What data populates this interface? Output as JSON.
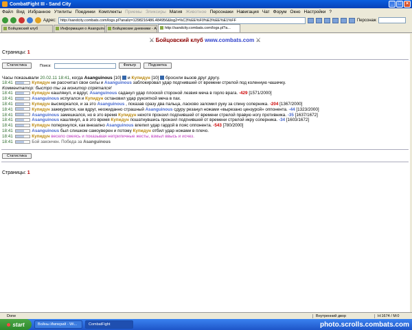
{
  "window": {
    "title": "CombatFight III - Sand City"
  },
  "menu": [
    "Файл",
    "Вид",
    "Избранное",
    "Утилиты",
    "Поединки",
    "Комплекты",
    "Приемы",
    "Эликсиры",
    "Магия",
    "Животное",
    "Персонажи",
    "Навигация",
    "Чат",
    "Форум",
    "Окно",
    "Настройки",
    "?"
  ],
  "menu_disabled": [
    "Приемы",
    "Эликсиры",
    "Животное"
  ],
  "toolbar": {
    "address_label": "Адрес:",
    "address_value": "http://sandcity.combats.com/logs.pl?analiz=1298216486.484956&log2=%C3%EE%F0%E3%EE%E1%FF",
    "persons_label": "Персонаж"
  },
  "tabs": [
    {
      "label": "Бойцовский клуб"
    },
    {
      "label": "Информация о Asanguinous"
    },
    {
      "label": "Бойцовские дневники - Asanguinous"
    },
    {
      "label": "http://sandcity.combats.com/logs.pl?a..."
    }
  ],
  "page": {
    "club_title": "Бойцовский клуб",
    "club_site": "www.combats.com",
    "pages_label": "Страницы:",
    "pages_value": "1",
    "buttons": {
      "stats": "Статистика",
      "search_label": "Поиск:",
      "filter": "Фильтр",
      "highlight": "Подсветка"
    },
    "intro": {
      "a": "Часы показывали",
      "time": "20.02.11 18:41",
      "b": ", когда",
      "p1": "Asanguinous",
      "p1lvl": "[10]",
      "c": "и",
      "p2": "Купидун",
      "p2lvl": "[10]",
      "d": "бросили вызов друг другу."
    },
    "log": [
      {
        "t": "18:41",
        "actor": "Купидун",
        "actor_color": "red",
        "text": "не рассчитал свои силы и",
        "target": "Asanguinous",
        "target_color": "blue",
        "rest": "заблокировал удар подгнившей от времени стрелой под коленную чашечку.",
        "dmg": "",
        "hp": ""
      },
      {
        "t": "",
        "comment": "Комментатор: быстро ты за монитор спрятался!"
      },
      {
        "t": "18:41",
        "actor": "Купидун",
        "actor_color": "red",
        "text": "кашлянул, и вдруг,",
        "target": "Asanguinous",
        "target_color": "blue",
        "rest": "саданул удар плоской стороной лезвия меча в горло врага.",
        "dmg": "-429",
        "hp": "[1571/2000]"
      },
      {
        "t": "18:41",
        "actor": "Asanguinous",
        "actor_color": "blue",
        "text": "испугался и",
        "target": "Купидун",
        "target_color": "red",
        "rest": "остановил удар рукояткой меча в пах.",
        "dmg": "",
        "hp": ""
      },
      {
        "t": "18:41",
        "actor": "Купидун",
        "actor_color": "red",
        "text": "высморкался, и за это",
        "target": "Asanguinous",
        "target_color": "blue",
        "rest": ", показав сразу два пальца, ласково заломил руку за спину соперника.",
        "dmg": "-204",
        "hp": "[1367/2000]"
      },
      {
        "t": "18:41",
        "actor": "Купидун",
        "actor_color": "red",
        "text": "зажмурился, как вдруг, неожиданно страшный",
        "target": "Asanguinous",
        "target_color": "blue",
        "rest": "сдуру резанул ножами «вырезано цензурой» оппонента.",
        "dmg": "-44",
        "hp": "[1323/2000]",
        "dmg_blue": true
      },
      {
        "t": "18:41",
        "actor": "Asanguinous",
        "actor_color": "blue",
        "text": "замешкался, но в это время",
        "target": "Купидун",
        "target_color": "red",
        "rest": "нехотя пронзил подгнившей от времени стрелой правую ногу противника.",
        "dmg": "-35",
        "hp": "[1637/1672]",
        "dmg_blue": true
      },
      {
        "t": "18:41",
        "actor": "Asanguinous",
        "actor_color": "blue",
        "text": "кашлянул, а в это время",
        "target": "Купидун",
        "target_color": "red",
        "rest": "пошатнувшись пронзил подгнившей от времени стрелой икру соперника.",
        "dmg": "-34",
        "hp": "[1603/1672]",
        "dmg_blue": true
      },
      {
        "t": "18:41",
        "actor": "Купидун",
        "actor_color": "red",
        "text": "поперхнулся, как внезапно",
        "target": "Asanguinous",
        "target_color": "blue",
        "rest": "влепил удар гардой в пояс оппонента.",
        "dmg": "-543",
        "hp": "[780/2000]"
      },
      {
        "t": "18:41",
        "actor": "Asanguinous",
        "actor_color": "blue",
        "text": "был слишком самоуверен и потому",
        "target": "Купидун",
        "target_color": "red",
        "rest": "отбил удар ножами в плечо.",
        "dmg": "",
        "hp": ""
      },
      {
        "t": "18:41",
        "actor": "Купидун",
        "actor_color": "red",
        "text": "",
        "target": "",
        "target_color": "",
        "rest": "весело смеясь и показывая неприличные жесты, взмыл ввысь и исчез.",
        "dmg": "",
        "hp": "",
        "magenta": true
      },
      {
        "t": "18:41",
        "actor": "",
        "actor_color": "",
        "text": "Бой закончен. Победа за",
        "target": "Asanguinous",
        "target_color": "blk",
        "rest": "",
        "dmg": "",
        "hp": "",
        "gray": true
      }
    ]
  },
  "statusbar": {
    "done": "Done",
    "zone": "Внутренний двор",
    "mem": "H:1674 / M:0"
  },
  "taskbar": {
    "start": "start",
    "items": [
      "Войны Империй - Wi...",
      "CombatFight"
    ],
    "watermark": "photo.scrolls.combats.com"
  }
}
